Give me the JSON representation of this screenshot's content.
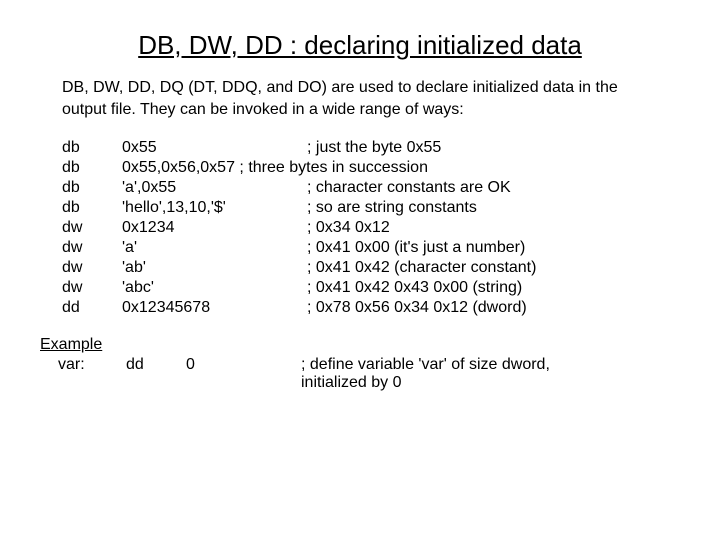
{
  "title": "DB, DW, DD : declaring initialized data",
  "intro": "DB, DW, DD, DQ (DT, DDQ, and DO) are used to declare initialized data in the output file. They can be invoked in a wide range of ways:",
  "rows": [
    {
      "op": "db",
      "args": "0x55",
      "comment": "; just the byte 0x55"
    },
    {
      "op": "db",
      "args": "0x55,0x56,0x57 ; three bytes in succession",
      "comment": ""
    },
    {
      "op": "db",
      "args": "'a',0x55",
      "comment": "; character constants are OK"
    },
    {
      "op": "db",
      "args": "'hello',13,10,'$'",
      "comment": "; so are string constants"
    },
    {
      "op": "dw",
      "args": "0x1234",
      "comment": "; 0x34 0x12"
    },
    {
      "op": "dw",
      "args": "'a'",
      "comment": "; 0x41 0x00 (it's just a number)"
    },
    {
      "op": "dw",
      "args": "'ab'",
      "comment": "; 0x41 0x42 (character constant)"
    },
    {
      "op": "dw",
      "args": "'abc'",
      "comment": "; 0x41 0x42 0x43 0x00 (string)"
    },
    {
      "op": "dd",
      "args": "0x12345678",
      "comment": "; 0x78 0x56 0x34 0x12 (dword)"
    }
  ],
  "example": {
    "label": "Example",
    "var": "var:",
    "op": "dd",
    "arg": "0",
    "comment1": "; define variable 'var' of size dword,",
    "comment2": "  initialized by 0"
  }
}
